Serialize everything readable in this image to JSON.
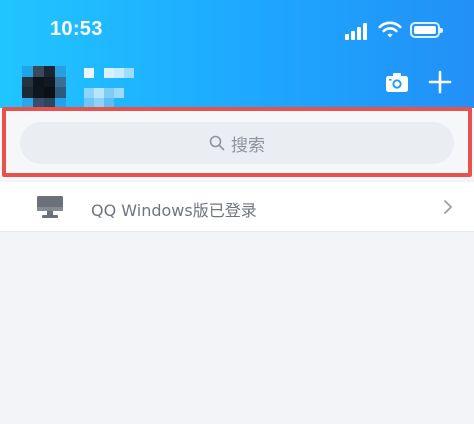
{
  "status_bar": {
    "time": "10:53",
    "signal_icon": "cellular-signal-icon",
    "wifi_icon": "wifi-icon",
    "battery_icon": "battery-icon"
  },
  "header": {
    "camera_icon": "camera-icon",
    "add_icon": "plus-icon"
  },
  "search": {
    "placeholder": "搜索",
    "icon": "search-icon"
  },
  "device_row": {
    "label": "QQ Windows版已登录",
    "icon": "monitor-icon",
    "chevron_icon": "chevron-right-icon"
  },
  "colors": {
    "header_gradient_start": "#20c5ff",
    "header_gradient_end": "#2290f7",
    "highlight_border": "#e8524d",
    "search_bg": "#eaedf2",
    "page_bg": "#f3f4f8"
  }
}
